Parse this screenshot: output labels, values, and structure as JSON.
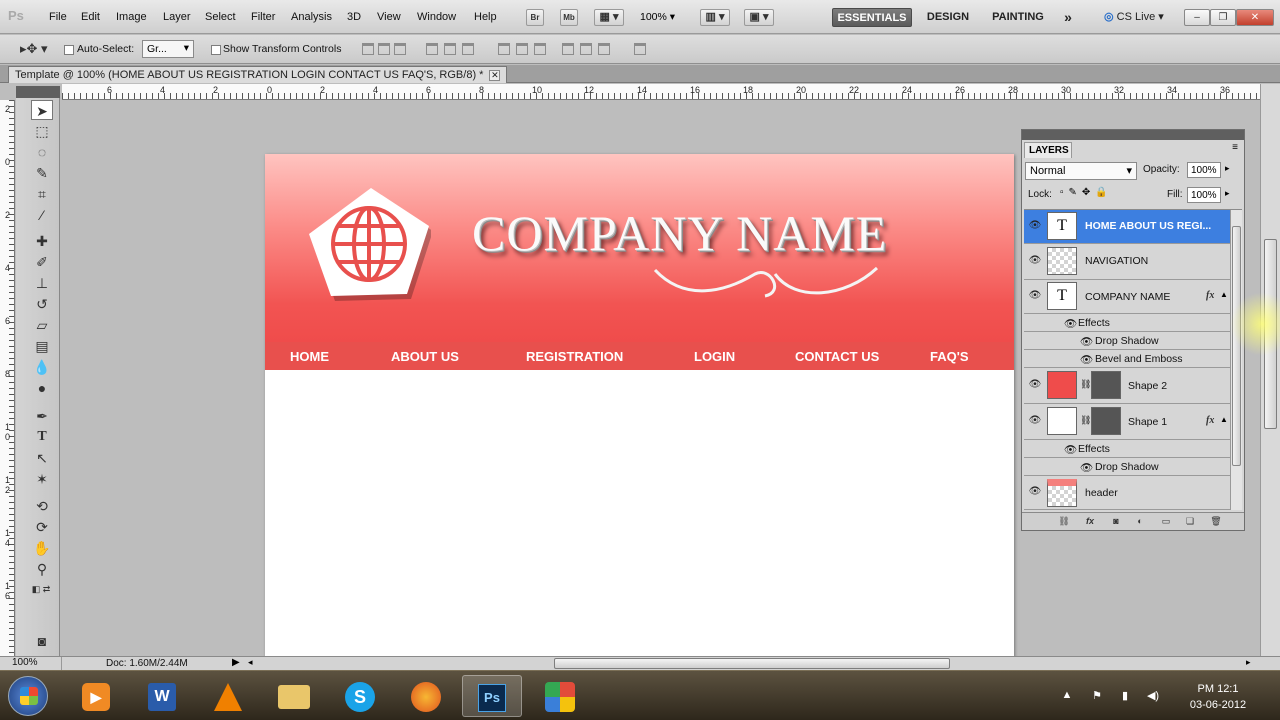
{
  "app": {
    "logo": "Ps",
    "menus": [
      "File",
      "Edit",
      "Image",
      "Layer",
      "Select",
      "Filter",
      "Analysis",
      "3D",
      "View",
      "Window",
      "Help"
    ]
  },
  "menubar_buttons": {
    "bridge": "Br",
    "mini_bridge": "Mb",
    "zoom": "100%"
  },
  "workspaces": {
    "essentials": "ESSENTIALS",
    "design": "DESIGN",
    "painting": "PAINTING",
    "more": "»",
    "cs_live": "CS Live"
  },
  "window_controls": {
    "minimize": "–",
    "restore": "❐",
    "close": "✕"
  },
  "options": {
    "auto_select_label": "Auto-Select:",
    "auto_select_value": "Gr...",
    "show_transform_label": "Show Transform Controls"
  },
  "document": {
    "tab_title": "Template @ 100% (HOME  ABOUT US  REGISTRATION  LOGIN  CONTACT US  FAQ'S, RGB/8) *",
    "close": "✕"
  },
  "ruler_top": [
    "6",
    "4",
    "2",
    "0",
    "2",
    "4",
    "6",
    "8",
    "10",
    "12",
    "14",
    "16",
    "18",
    "20",
    "22",
    "24",
    "26",
    "28",
    "30",
    "32",
    "34",
    "36"
  ],
  "ruler_left": [
    "2",
    "0",
    "2",
    "4",
    "6",
    "8",
    "1\n0",
    "1\n2",
    "1\n4",
    "1\n6"
  ],
  "canvas": {
    "company_name": "COMPANY NAME",
    "nav": [
      "HOME",
      "ABOUT US",
      "REGISTRATION",
      "LOGIN",
      "CONTACT US",
      "FAQ'S"
    ],
    "colors": {
      "header_top": "#ffc4c0",
      "header_bottom": "#ef4c4b",
      "nav_bg": "#e8504d",
      "logo_globe": "#e8504d"
    }
  },
  "status": {
    "zoom": "100%",
    "doc_info": "Doc: 1.60M/2.44M"
  },
  "layers_panel": {
    "title": "LAYERS",
    "blend_mode": "Normal",
    "opacity_label": "Opacity:",
    "opacity": "100%",
    "lock_label": "Lock:",
    "fill_label": "Fill:",
    "fill": "100%",
    "layers": [
      {
        "name": "HOME  ABOUT US  REGI...",
        "type": "text",
        "selected": true
      },
      {
        "name": "NAVIGATION",
        "type": "raster"
      },
      {
        "name": "COMPANY NAME",
        "type": "text",
        "fx": "fx",
        "effects_label": "Effects",
        "effects": [
          "Drop Shadow",
          "Bevel and Emboss"
        ]
      },
      {
        "name": "Shape 2",
        "type": "shape"
      },
      {
        "name": "Shape 1",
        "type": "shape",
        "fx": "fx",
        "effects_label": "Effects",
        "effects": [
          "Drop Shadow"
        ]
      },
      {
        "name": "header",
        "type": "raster"
      }
    ]
  },
  "taskbar": {
    "apps": [
      "media-player",
      "word",
      "vlc",
      "explorer",
      "skype",
      "firefox",
      "photoshop",
      "app-launcher"
    ],
    "active_app": "photoshop",
    "clock_time": "PM 12:1",
    "clock_date": "03-06-2012"
  }
}
